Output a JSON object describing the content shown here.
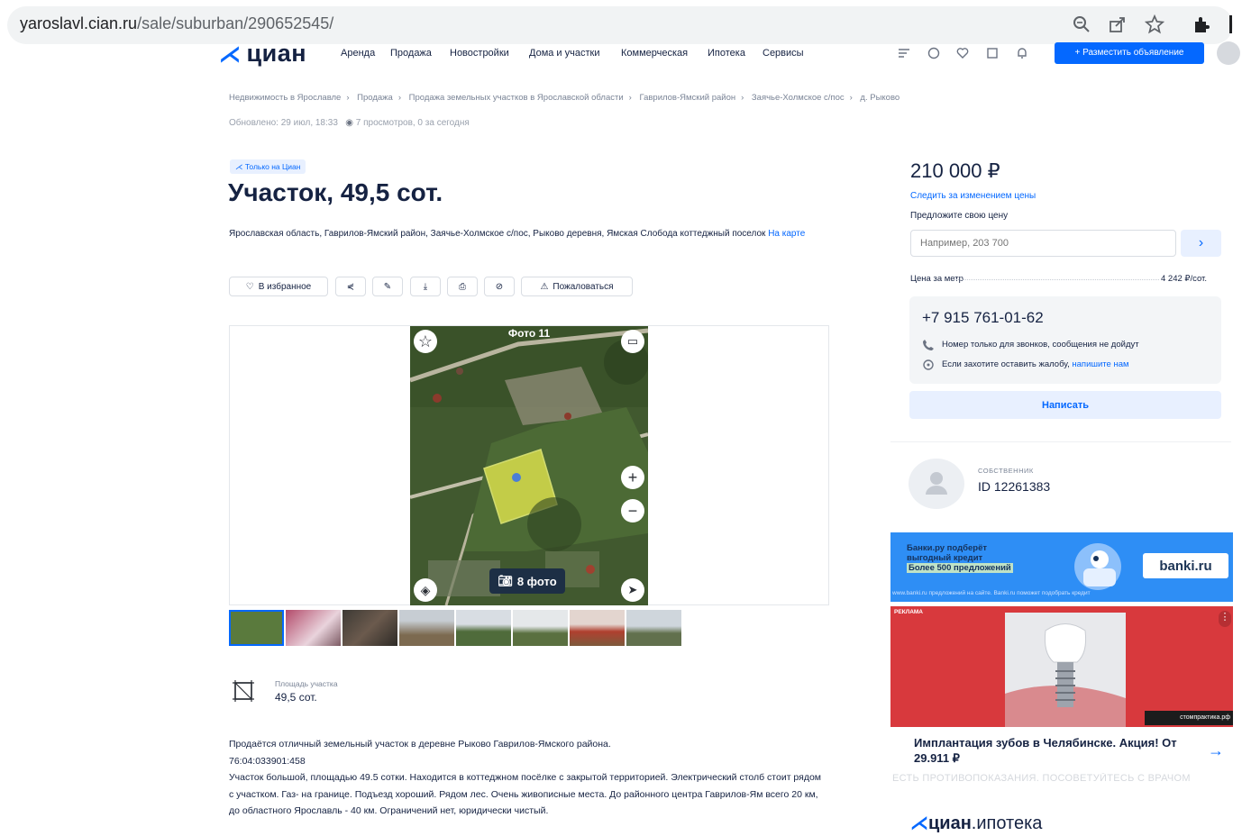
{
  "browser": {
    "url_host": "yaroslavl.cian.ru",
    "url_path": "/sale/suburban/290652545/"
  },
  "header": {
    "logo_text": "циан",
    "nav": [
      "Аренда",
      "Продажа",
      "Новостройки",
      "Дома и участки",
      "Коммерческая",
      "Ипотека",
      "Сервисы"
    ],
    "post_button": "+ Разместить объявление"
  },
  "breadcrumbs": [
    "Недвижимость в Ярославле",
    "Продажа",
    "Продажа земельных участков в Ярославской области",
    "Гаврилов-Ямский район",
    "Заячье-Холмское с/пос",
    "д. Рыково"
  ],
  "meta": {
    "updated": "Обновлено: 29 июл, 18:33",
    "views": "7 просмотров, 0 за сегодня"
  },
  "listing": {
    "badge": "Только на Циан",
    "title": "Участок, 49,5 сот.",
    "address": "Ярославская область, Гаврилов-Ямский район, Заячье-Холмское с/пос, Рыково деревня, Ямская Слобода коттеджный поселок",
    "map_link": "На карте"
  },
  "actions": {
    "favorite": "В избранное",
    "complain": "Пожаловаться"
  },
  "gallery": {
    "top_label": "Фото 11",
    "photo_count": "8 фото",
    "thumb_count": 8
  },
  "area": {
    "label": "Площадь участка",
    "value": "49,5 сот."
  },
  "description": {
    "p1": "Продаётся отличный земельный участок в деревне Рыково Гаврилов-Ямского района.",
    "p2": "76:04:033901:458",
    "p3": "Участок большой, площадью 49.5 сотки. Находится в коттеджном посёлке с закрытой территорией. Электрический столб стоит рядом с участком. Газ- на границе. Подъезд хороший. Рядом лес. Очень живописные места. До районного центра Гаврилов-Ям всего 20 км, до областного Ярославль - 40 км. Ограничений нет, юридически чистый."
  },
  "sidebar": {
    "price": "210 000 ₽",
    "follow_price": "Следить за изменением цены",
    "offer_label": "Предложите свою цену",
    "offer_placeholder": "Например, 203 700",
    "price_per_label": "Цена за метр",
    "price_per_value": "4 242 ₽/сот.",
    "phone": "+7 915 761-01-62",
    "phone_note": "Номер только для звонков, сообщения не дойдут",
    "complaint_text": "Если захотите оставить жалобу,",
    "complaint_link": "напишите нам",
    "write_button": "Написать",
    "owner_role": "СОБСТВЕННИК",
    "owner_id": "ID 12261383"
  },
  "ads": {
    "banki_line1": "Банки.ру подберёт",
    "banki_line2": "выгодный кредит",
    "banki_line3": "Более 500 предложений",
    "banki_logo": "banki.ru",
    "banki_foot": "www.banki.ru предложений на сайте. Banki.ru поможет подобрать кредит",
    "ad_tag": "РЕКЛАМА",
    "implant_site": "стомпрактика.рф",
    "implant_headline": "Имплантация зубов в Челябинске. Акция! От 29.911 ₽",
    "implant_disclaimer": "ЕСТЬ ПРОТИВОПОКАЗАНИЯ. ПОСОВЕТУЙТЕСЬ С ВРАЧОМ",
    "cian_ipoteka_b": "циан",
    "cian_ipoteka_rest": ".ипотека"
  },
  "colors": {
    "accent": "#0468ff",
    "text": "#152242",
    "ad_red": "#d8393d",
    "ad_blue": "#2e8ef5"
  }
}
